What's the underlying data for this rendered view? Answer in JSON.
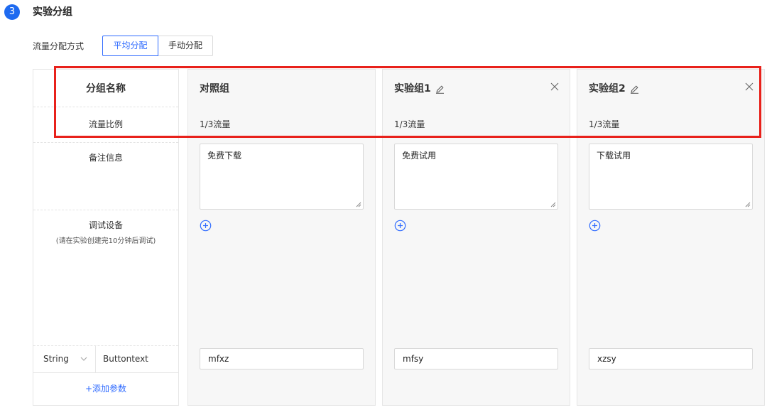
{
  "section": {
    "step_number": "3",
    "title": "实验分组"
  },
  "distribution": {
    "label": "流量分配方式",
    "options": [
      "平均分配",
      "手动分配"
    ],
    "selected": "平均分配"
  },
  "labels": {
    "group_name": "分组名称",
    "traffic_ratio": "流量比例",
    "remark": "备注信息",
    "debug_device": "调试设备",
    "debug_hint": "(请在实验创建完10分钟后调试)"
  },
  "param": {
    "type": "String",
    "name": "Buttontext",
    "add_label": "+添加参数"
  },
  "groups": [
    {
      "name": "对照组",
      "ratio": "1/3流量",
      "remark": "免费下载",
      "param_value": "mfxz",
      "editable": false,
      "closable": false
    },
    {
      "name": "实验组1",
      "ratio": "1/3流量",
      "remark": "免费试用",
      "param_value": "mfsy",
      "editable": true,
      "closable": true
    },
    {
      "name": "实验组2",
      "ratio": "1/3流量",
      "remark": "下载试用",
      "param_value": "xzsy",
      "editable": true,
      "closable": true
    }
  ],
  "colors": {
    "accent": "#2f6bff",
    "step_circle": "#1e6af0",
    "highlight": "#e8211b",
    "card_bg": "#f7f7f7"
  },
  "icons": {
    "edit": "pencil-icon",
    "close": "close-icon",
    "add_device": "plus-circle-icon",
    "select": "chevron-down-icon"
  }
}
